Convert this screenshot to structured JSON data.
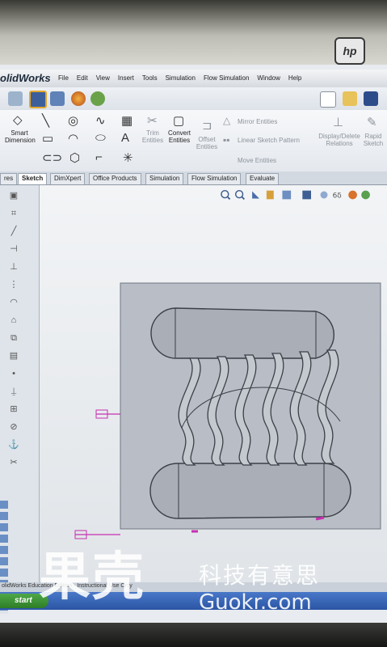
{
  "app": {
    "name": "olidWorks"
  },
  "menu": [
    "File",
    "Edit",
    "View",
    "Insert",
    "Tools",
    "Simulation",
    "Flow Simulation",
    "Window",
    "Help"
  ],
  "ribbon": {
    "smart_dimension": "Smart Dimension",
    "trim_entities": "Trim Entities",
    "convert_entities": "Convert Entities",
    "offset_entities": "Offset Entities",
    "mirror_entities": "Mirror Entities",
    "linear_sketch_pattern": "Linear Sketch Pattern",
    "move_entities": "Move Entities",
    "display_delete_relations": "Display/Delete Relations",
    "rapid_sketch": "Rapid Sketch"
  },
  "tabs": [
    "res",
    "Sketch",
    "DimXpert",
    "Office Products",
    "Simulation",
    "Flow Simulation",
    "Evaluate"
  ],
  "active_tab": "Sketch",
  "statusbar": {
    "text": "olidWorks Education Edition - Instructional Use Only"
  },
  "taskbar": {
    "start": "start"
  },
  "watermark": {
    "big": "果壳",
    "small": "科技有意思",
    "url": "Guokr.com"
  },
  "brand": {
    "logo": "hp"
  },
  "colors": {
    "accent": "#c62fb0",
    "taskbar": "#2b55a5"
  }
}
